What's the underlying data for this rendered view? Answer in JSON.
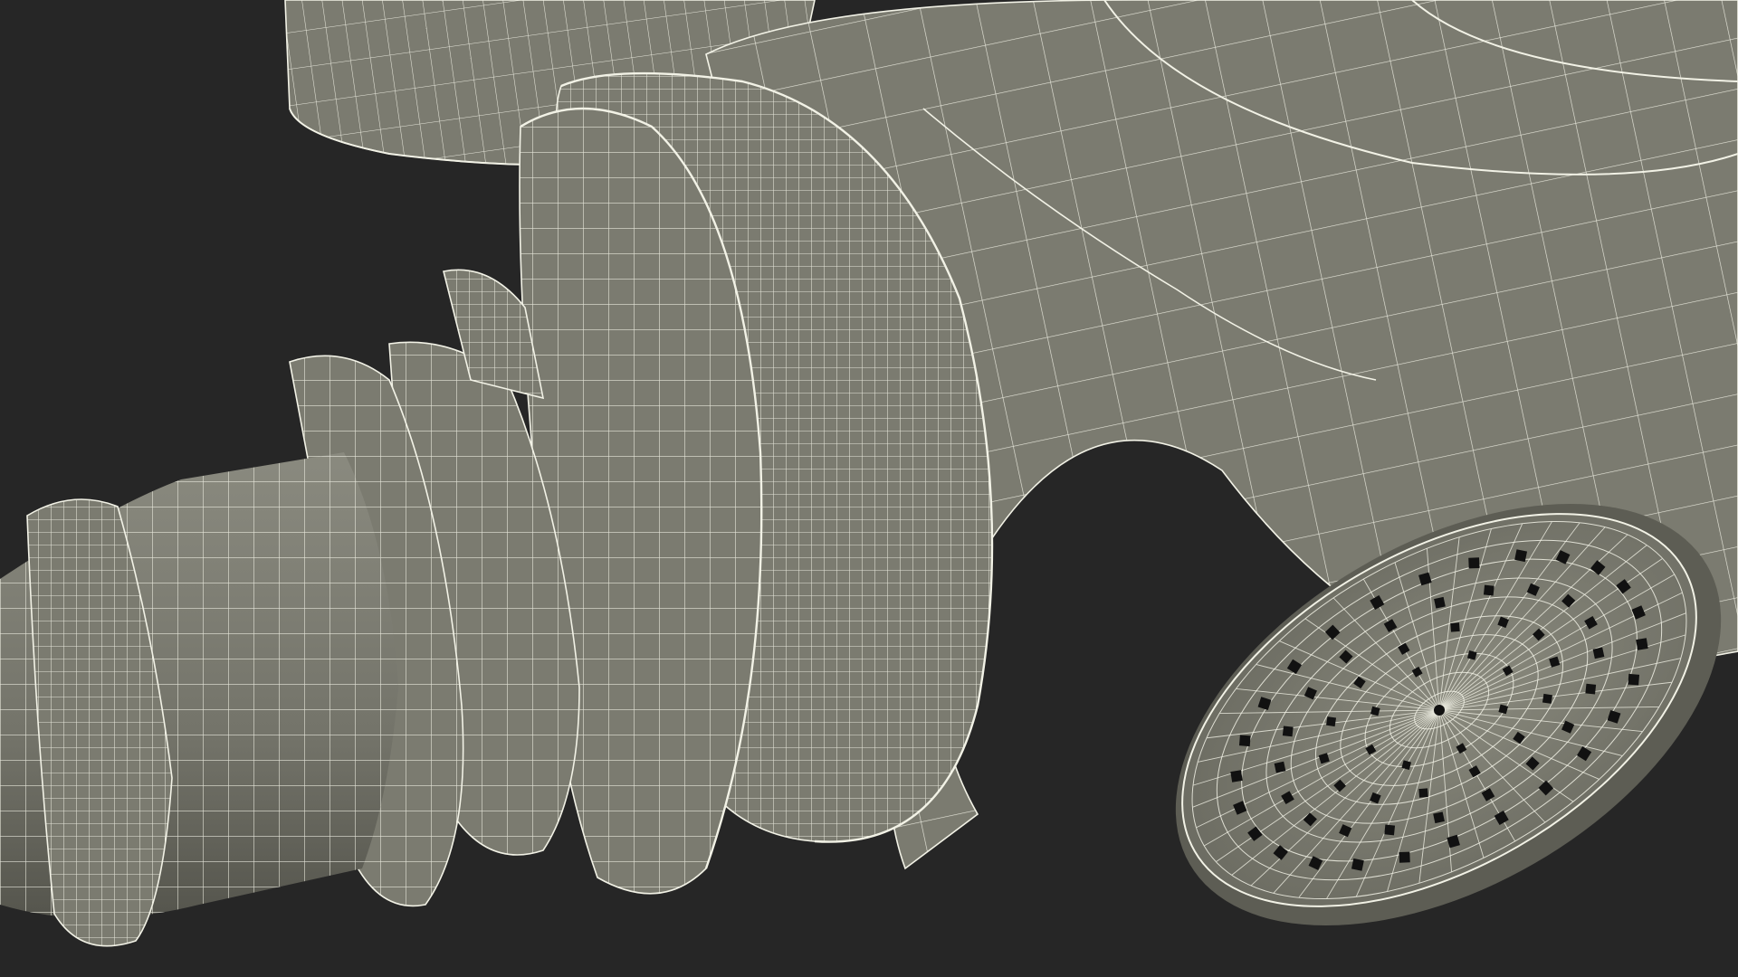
{
  "scene": {
    "subject": "gas-mask-hose-wireframe",
    "colors": {
      "background": "#262626",
      "surface": "#7b7b70",
      "surface_light": "#8c8c80",
      "surface_dark": "#5d5d54",
      "wire": "#f2f2e6",
      "hole": "#111111"
    }
  }
}
